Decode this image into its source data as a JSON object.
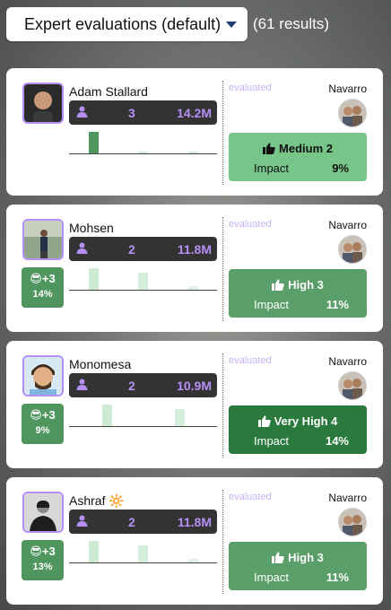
{
  "header": {
    "sort_label": "Expert evaluations (default)",
    "result_count": "(61 results)"
  },
  "cards": [
    {
      "name": "Adam Stallard",
      "count": "3",
      "views": "14.2M",
      "bars": [
        1.0,
        0.08,
        0.08
      ],
      "bar_colors": [
        "#4f955e",
        "#d4ecd8",
        "#d4ecd8"
      ],
      "boost": null,
      "evaluated_label": "evaluated",
      "evaluator": "Navarro",
      "impact_level": "Medium 2",
      "impact_label": "Impact",
      "impact_pct": "9%",
      "impact_color": "#77c589",
      "impact_text_color": "#111111"
    },
    {
      "name": "Mohsen",
      "count": "2",
      "views": "11.8M",
      "bars": [
        1.0,
        0.78,
        0.18
      ],
      "bar_colors": [
        "#cdebd4",
        "#d6efdc",
        "#dff2e3"
      ],
      "boost": {
        "emoji": "😎",
        "value": "+3",
        "pct": "14%"
      },
      "evaluated_label": "evaluated",
      "evaluator": "Navarro",
      "impact_level": "High 3",
      "impact_label": "Impact",
      "impact_pct": "11%",
      "impact_color": "#5a9e69",
      "impact_text_color": "#ffffff"
    },
    {
      "name": "Monomesa",
      "count": "2",
      "views": "10.9M",
      "bars": [
        1.0,
        0.78
      ],
      "bar_colors": [
        "#cdebd4",
        "#d6efdc"
      ],
      "boost": {
        "emoji": "😎",
        "value": "+3",
        "pct": "9%"
      },
      "evaluated_label": "evaluated",
      "evaluator": "Navarro",
      "impact_level": "Very High 4",
      "impact_label": "Impact",
      "impact_pct": "14%",
      "impact_color": "#2b7a3d",
      "impact_text_color": "#ffffff"
    },
    {
      "name": "Ashraf 🔆",
      "count": "2",
      "views": "11.8M",
      "bars": [
        1.0,
        0.78,
        0.18
      ],
      "bar_colors": [
        "#cdebd4",
        "#d6efdc",
        "#dff2e3"
      ],
      "boost": {
        "emoji": "😎",
        "value": "+3",
        "pct": "13%"
      },
      "evaluated_label": "evaluated",
      "evaluator": "Navarro",
      "impact_level": "High 3",
      "impact_label": "Impact",
      "impact_pct": "11%",
      "impact_color": "#5a9e69",
      "impact_text_color": "#ffffff"
    }
  ]
}
